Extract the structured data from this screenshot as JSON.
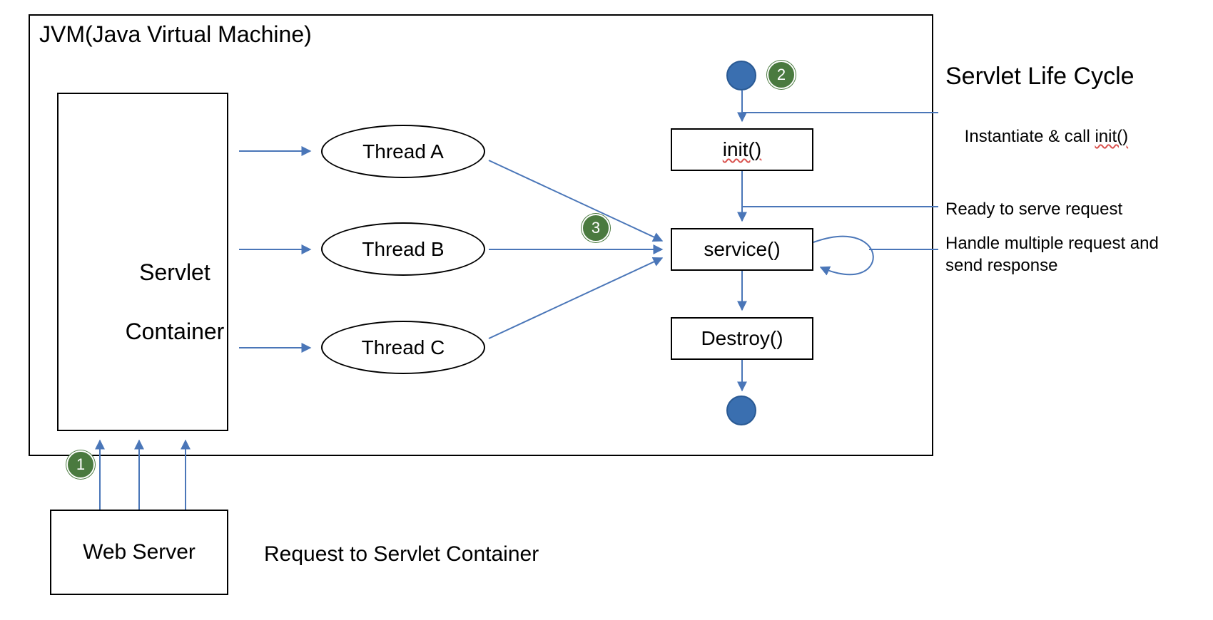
{
  "jvm": {
    "title": "JVM(Java Virtual Machine)"
  },
  "servlet_container": {
    "label_line1": "Servlet",
    "label_line2": "Container"
  },
  "threads": {
    "a": "Thread A",
    "b": "Thread B",
    "c": "Thread C"
  },
  "lifecycle": {
    "title": "Servlet Life Cycle",
    "init": "init()",
    "service": "service()",
    "destroy": "Destroy()"
  },
  "annotations": {
    "instantiate_prefix": "Instantiate & call ",
    "instantiate_method": "init()",
    "ready": "Ready to serve request",
    "handle_line1": "Handle multiple request and",
    "handle_line2": "send response"
  },
  "web_server": {
    "label": "Web Server",
    "request_label": "Request to Servlet Container"
  },
  "badges": {
    "n1": "1",
    "n2": "2",
    "n3": "3"
  },
  "colors": {
    "arrow": "#4a76b8",
    "badge_green": "#4a7a3f",
    "circle_blue": "#3a6fb0"
  }
}
